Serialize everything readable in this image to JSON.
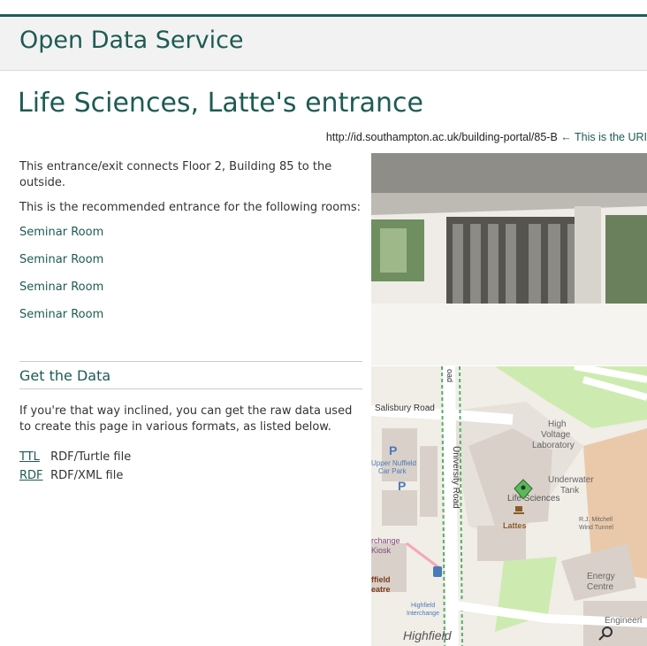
{
  "site": {
    "title": "Open Data Service"
  },
  "page": {
    "title": "Life Sciences, Latte's entrance",
    "uri": "http://id.southampton.ac.uk/building-portal/85-B",
    "uri_note": "← This is the URI",
    "intro": "This entrance/exit connects Floor 2, Building 85 to the outside.",
    "recommended": "This is the recommended entrance for the following rooms:",
    "rooms": [
      "Seminar Room",
      "Seminar Room",
      "Seminar Room",
      "Seminar Room"
    ]
  },
  "get_data": {
    "heading": "Get the Data",
    "description": "If you're that way inclined, you can get the raw data used to create this page in various formats, as listed below.",
    "formats": [
      {
        "code": "TTL",
        "label": "RDF/Turtle file"
      },
      {
        "code": "RDF",
        "label": "RDF/XML file"
      }
    ]
  },
  "map": {
    "labels": {
      "salisbury": "Salisbury Road",
      "high_voltage_1": "High",
      "high_voltage_2": "Voltage",
      "high_voltage_3": "Laboratory",
      "nuffield_1": "Upper Nuffield",
      "nuffield_2": "Car Park",
      "university_road": "University Road",
      "underwater_1": "Underwater",
      "underwater_2": "Tank",
      "life_sciences": "Life Sciences",
      "lattes": "Lattes",
      "mitchell_1": "R.J. Mitchell",
      "mitchell_2": "Wind Tunnel",
      "interchange_kiosk_1": "rchange",
      "interchange_kiosk_2": "Kiosk",
      "nuffield_theatre_1": "ffield",
      "nuffield_theatre_2": "eatre",
      "energy_1": "Energy",
      "energy_2": "Centre",
      "highfield_interchange_1": "Highfield",
      "highfield_interchange_2": "Interchange",
      "engineering": "Engineeri",
      "highfield": "Highfield",
      "road_fragment": "oad"
    },
    "colors": {
      "road": "#ffffff",
      "building": "#d9d0c9",
      "grass": "#cdebb0",
      "marker": "#5cb85c"
    }
  }
}
